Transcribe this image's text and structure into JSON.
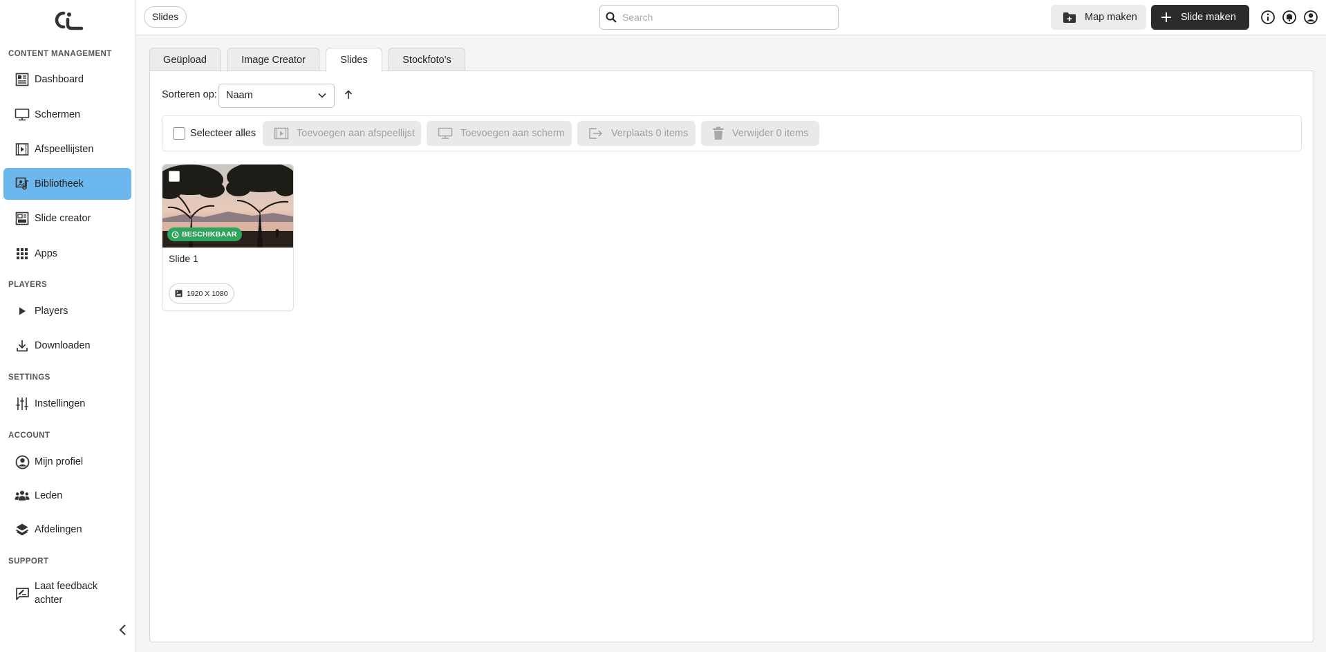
{
  "app": {
    "logo_name": "app-logo",
    "colors": {
      "accent": "#6db7ef",
      "primary_button": "#2b2b2b",
      "success": "#2ea55a"
    }
  },
  "sidebar": {
    "sections": {
      "content": "CONTENT MANAGEMENT",
      "players": "PLAYERS",
      "settings": "SETTINGS",
      "account": "ACCOUNT",
      "support": "SUPPORT"
    },
    "items": {
      "dashboard": "Dashboard",
      "schermen": "Schermen",
      "afspeellijsten": "Afspeellijsten",
      "bibliotheek": "Bibliotheek",
      "slide_creator": "Slide creator",
      "apps": "Apps",
      "players": "Players",
      "downloaden": "Downloaden",
      "instellingen": "Instellingen",
      "mijn_profiel": "Mijn profiel",
      "leden": "Leden",
      "afdelingen": "Afdelingen",
      "feedback_line1": "Laat feedback",
      "feedback_line2": "achter"
    },
    "active": "bibliotheek"
  },
  "header": {
    "breadcrumb": "Slides",
    "search_placeholder": "Search",
    "search_value": "",
    "map_button": "Map maken",
    "slide_button": "Slide maken"
  },
  "tabs": [
    "Geüpload",
    "Image Creator",
    "Slides",
    "Stockfoto's"
  ],
  "active_tab": "Slides",
  "sort": {
    "label": "Sorteren op:",
    "value": "Naam",
    "direction": "ascending"
  },
  "toolbar": {
    "select_all": "Selecteer alles",
    "add_playlist": "Toevoegen aan afspeellijst",
    "add_screen": "Toevoegen aan scherm",
    "move": "Verplaats 0 items",
    "delete": "Verwijder 0 items"
  },
  "slides": [
    {
      "title": "Slide 1",
      "status": "BESCHIKBAAR",
      "resolution": "1920 X 1080"
    }
  ]
}
